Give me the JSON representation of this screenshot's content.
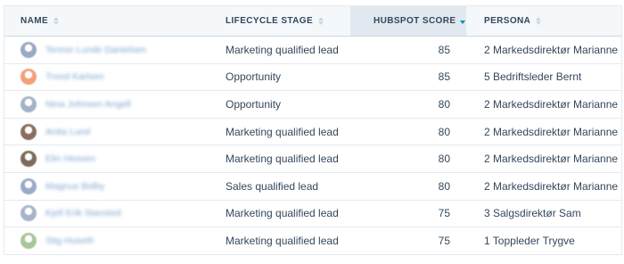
{
  "columns": {
    "name": "NAME",
    "lifecycle_stage": "LIFECYCLE STAGE",
    "hubspot_score": "HUBSPOT SCORE",
    "persona": "PERSONA"
  },
  "rows": [
    {
      "name": "Terese Lunde Danielsen",
      "avatar_color": "#9aa9c2",
      "lifecycle_stage": "Marketing qualified lead",
      "score": "85",
      "persona": "2 Markedsdirektør Marianne"
    },
    {
      "name": "Trond Karlsen",
      "avatar_color": "#f2a07a",
      "lifecycle_stage": "Opportunity",
      "score": "85",
      "persona": "5 Bedriftsleder Bernt"
    },
    {
      "name": "Nina Johnsen Angell",
      "avatar_color": "#a3b2c9",
      "lifecycle_stage": "Opportunity",
      "score": "80",
      "persona": "2 Markedsdirektør Marianne"
    },
    {
      "name": "Anita Lund",
      "avatar_color": "#8a6e5c",
      "lifecycle_stage": "Marketing qualified lead",
      "score": "80",
      "persona": "2 Markedsdirektør Marianne"
    },
    {
      "name": "Elin Hessen",
      "avatar_color": "#7d6a58",
      "lifecycle_stage": "Marketing qualified lead",
      "score": "80",
      "persona": "2 Markedsdirektør Marianne"
    },
    {
      "name": "Magnus Bidby",
      "avatar_color": "#9aabc8",
      "lifecycle_stage": "Sales qualified lead",
      "score": "80",
      "persona": "2 Markedsdirektør Marianne"
    },
    {
      "name": "Kjell Erik Stavsted",
      "avatar_color": "#a6b4cb",
      "lifecycle_stage": "Marketing qualified lead",
      "score": "75",
      "persona": "3 Salgsdirektør Sam"
    },
    {
      "name": "Stig Huseth",
      "avatar_color": "#a9c59a",
      "lifecycle_stage": "Marketing qualified lead",
      "score": "75",
      "persona": "1 Toppleder Trygve"
    }
  ],
  "colors": {
    "header_bg": "#f5f8fa",
    "sorted_header_bg": "#e1e8ef",
    "sort_active": "#0091ae",
    "text": "#33475b",
    "link": "#7fa8cf"
  },
  "icons": {
    "sort": "sort-icon",
    "sort_active": "sort-descending-icon"
  }
}
